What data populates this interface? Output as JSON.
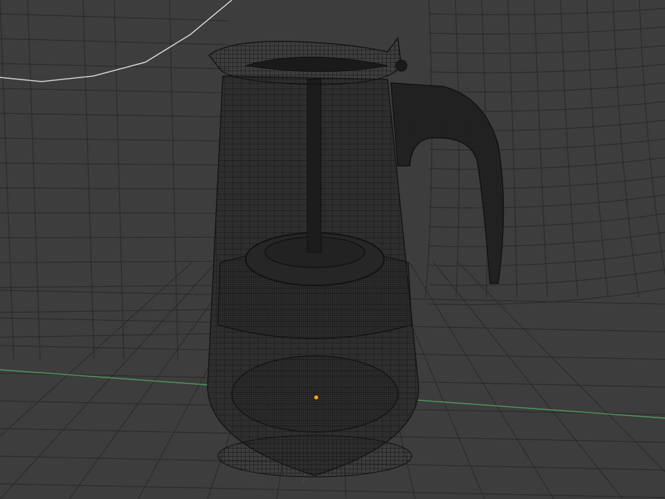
{
  "viewport": {
    "mode": "wireframe",
    "object": "french-press-wireframe",
    "grid": "on",
    "colors": {
      "background": "#3d3d3d",
      "grid_line": "#2b2b2b",
      "wire": "#141414",
      "x_axis": "#4e9a5e",
      "y_axis": "#8a4040",
      "selected_outline": "#d8d8d8",
      "origin": "#f0a020"
    }
  }
}
